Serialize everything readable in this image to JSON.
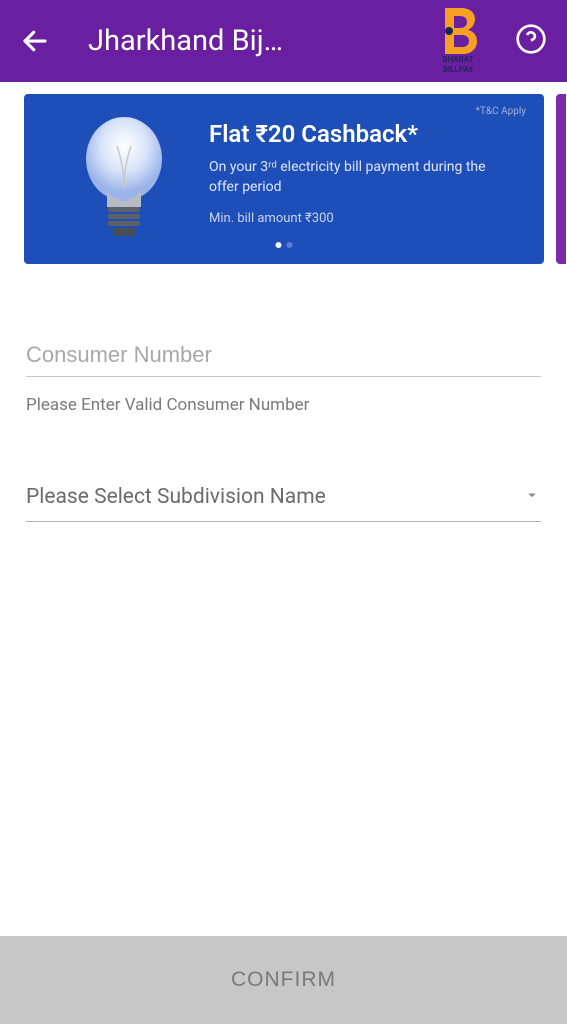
{
  "header": {
    "title": "Jharkhand Bij…"
  },
  "bharat": {
    "line1": "BHARAT",
    "line2": "BILLPAY"
  },
  "banner": {
    "title": "Flat ₹20 Cashback*",
    "subtitle": "On your 3ʳᵈ electricity bill payment during the offer period",
    "min": "Min. bill amount ₹300",
    "tc": "*T&C Apply"
  },
  "form": {
    "consumer_placeholder": "Consumer Number",
    "helper": "Please Enter Valid Consumer Number",
    "subdivision_placeholder": "Please Select Subdivision Name"
  },
  "actions": {
    "confirm": "CONFIRM"
  }
}
